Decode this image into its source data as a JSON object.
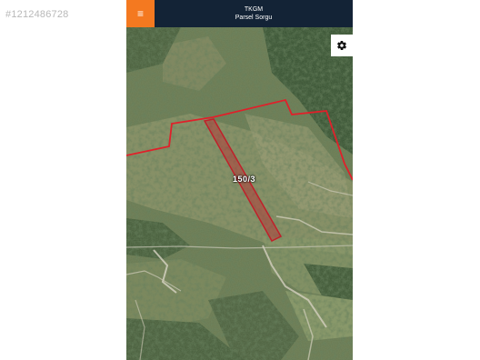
{
  "watermark": {
    "listing_id": "#1212486728"
  },
  "header": {
    "title": "TKGM",
    "subtitle": "Parsel Sorgu",
    "menu_icon": "hamburger-icon",
    "menu_glyph": "≡",
    "background_color": "#132336",
    "menu_color": "#f47920"
  },
  "toolbar": {
    "settings_icon": "gear-icon"
  },
  "map": {
    "parcel_label": "150/3",
    "parcel_outline_color": "#c0202a",
    "boundary_color": "#e0202a"
  }
}
